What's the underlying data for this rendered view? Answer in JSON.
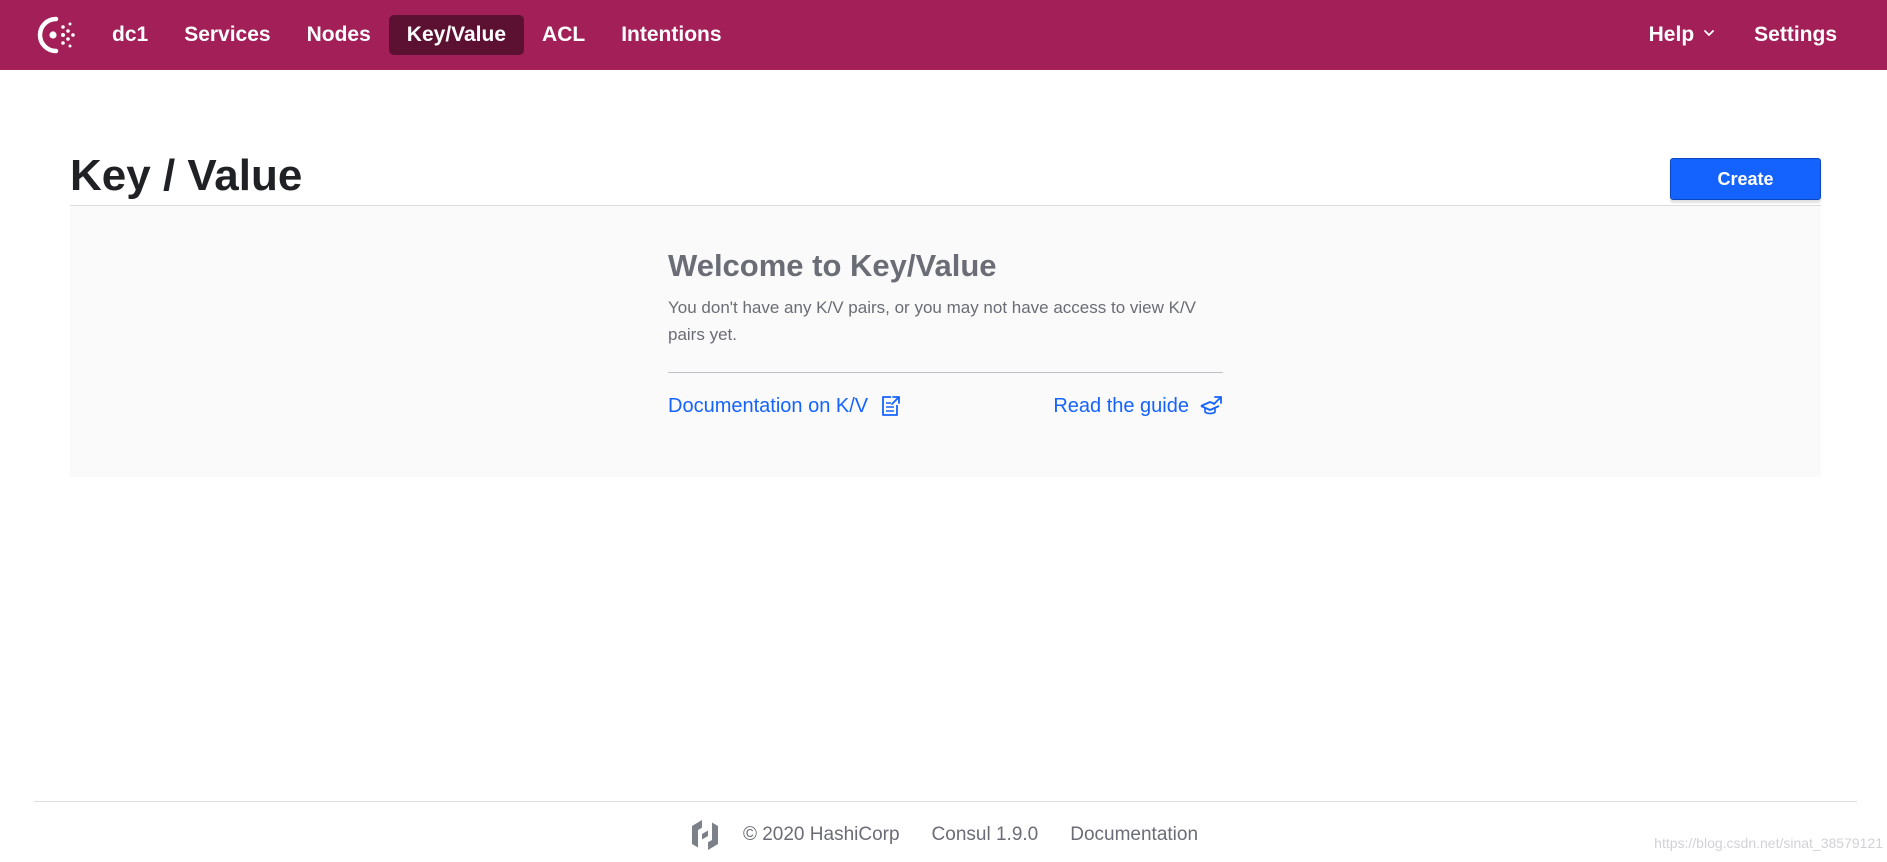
{
  "nav": {
    "datacenter": "dc1",
    "items": [
      {
        "label": "Services"
      },
      {
        "label": "Nodes"
      },
      {
        "label": "Key/Value"
      },
      {
        "label": "ACL"
      },
      {
        "label": "Intentions"
      }
    ],
    "active": "Key/Value",
    "help_label": "Help",
    "settings_label": "Settings"
  },
  "page": {
    "title": "Key / Value",
    "create_label": "Create"
  },
  "empty_state": {
    "title": "Welcome to Key/Value",
    "body": "You don't have any K/V pairs, or you may not have access to view K/V pairs yet.",
    "docs_link": "Documentation on K/V",
    "guide_link": "Read the guide"
  },
  "footer": {
    "copyright": "© 2020 HashiCorp",
    "version": "Consul 1.9.0",
    "docs_link": "Documentation"
  },
  "watermark": "https://blog.csdn.net/sinat_38579121",
  "colors": {
    "brand": "#a21f58",
    "nav_active": "#5c1133",
    "primary": "#1563ff",
    "muted_text": "#6a6d75"
  }
}
